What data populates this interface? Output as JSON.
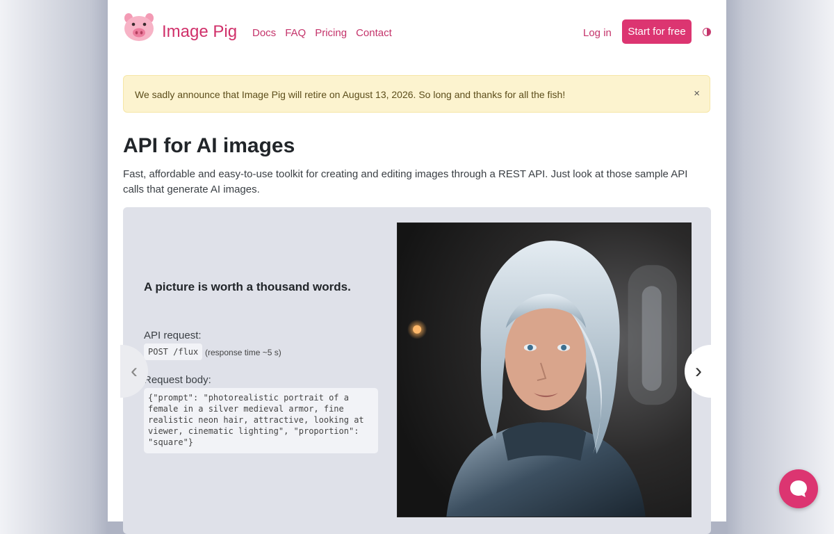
{
  "header": {
    "brand": "Image Pig",
    "nav": [
      "Docs",
      "FAQ",
      "Pricing",
      "Contact"
    ],
    "login": "Log in",
    "start_button": "Start for free"
  },
  "alert": {
    "text": "We sadly announce that Image Pig will retire on August 13, 2026. So long and thanks for all the fish!",
    "close": "×"
  },
  "hero": {
    "title": "API for AI images",
    "intro": "Fast, affordable and easy-to-use toolkit for creating and editing images through a REST API. Just look at those sample API calls that generate AI images."
  },
  "carousel": {
    "tagline": "A picture is worth a thousand words.",
    "request_label": "API request:",
    "endpoint": "POST /flux",
    "response_time": "(response time ~5 s)",
    "body_label": "Request body:",
    "body_code": "{\"prompt\": \"photorealistic portrait of a female in a silver medieval armor, fine realistic neon hair, attractive, looking at viewer, cinematic lighting\", \"proportion\": \"square\"}",
    "prev": "‹",
    "next": "›"
  },
  "colors": {
    "accent": "#dc3571",
    "alert_bg": "#fcf3cf",
    "carousel_bg": "#dfe1e9"
  },
  "icons": [
    "pig-logo-icon",
    "theme-toggle-icon",
    "close-icon",
    "chevron-left-icon",
    "chevron-right-icon",
    "chat-icon"
  ]
}
